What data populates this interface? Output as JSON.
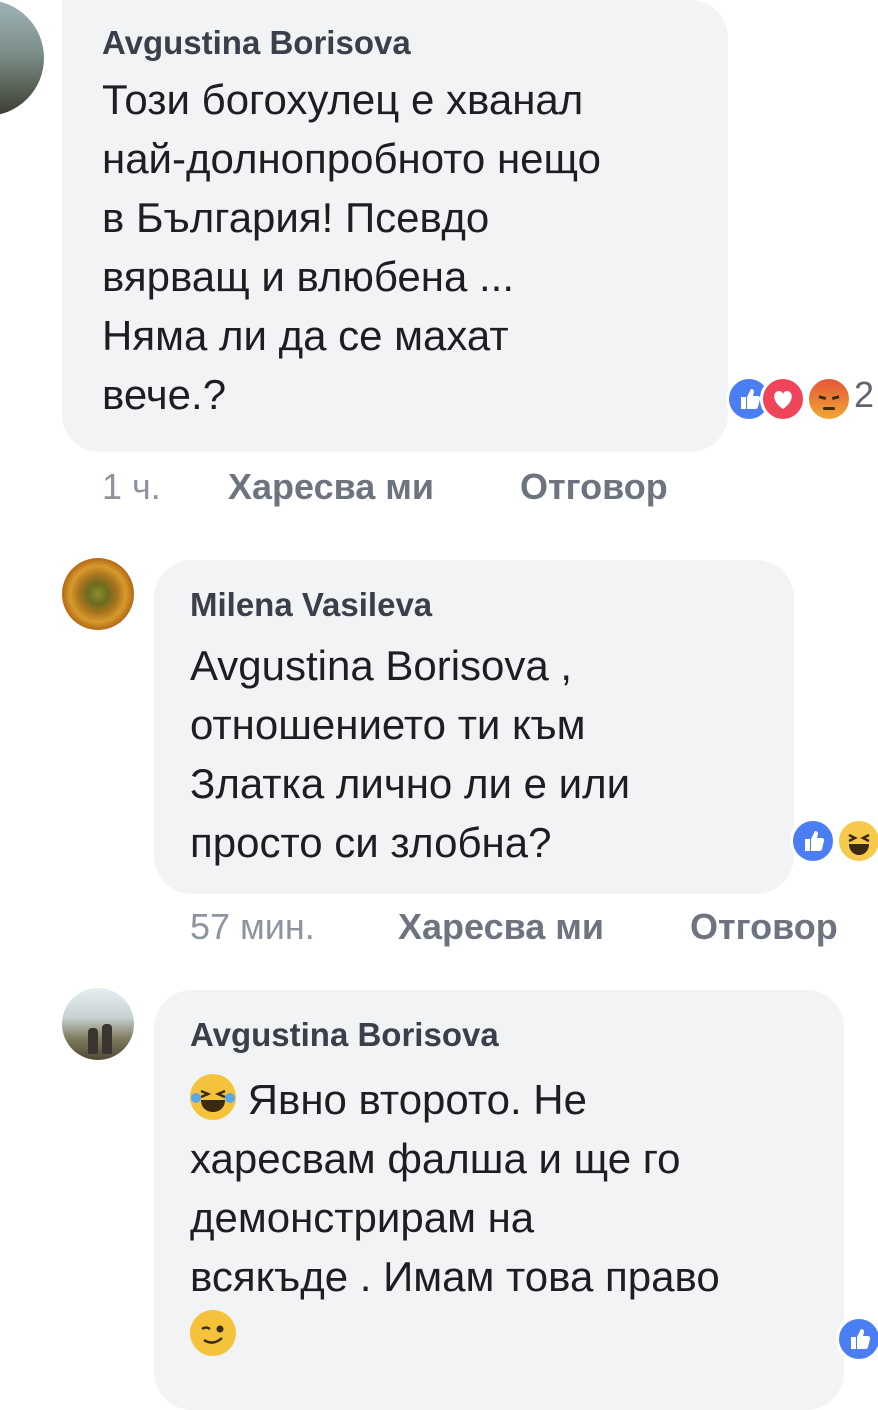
{
  "comments": [
    {
      "author": "Avgustina Borisova",
      "lines": [
        "Този богохулец е хванал",
        "най-долнопробното нещо",
        "в България! Псевдо",
        "вярващ и влюбена ...",
        "Няма ли да се махат",
        "вече.?"
      ],
      "time": "1 ч.",
      "like_label": "Харесва ми",
      "reply_label": "Отговор",
      "reactions": [
        "like-icon",
        "love-icon",
        "angry-icon"
      ],
      "reaction_count": "2"
    },
    {
      "author": "Milena Vasileva",
      "lines": [
        "Avgustina Borisova ,",
        "отношението ти към",
        "Златка лично ли е или",
        "просто си злобна?"
      ],
      "time": "57 мин.",
      "like_label": "Харесва ми",
      "reply_label": "Отговор",
      "reactions": [
        "like-icon",
        "haha-icon"
      ]
    },
    {
      "author": "Avgustina Borisova",
      "lines": [
        " Явно второто. Не",
        "харесвам фалша и ще го",
        "демонстрирам на",
        "всякъде . Имам това право"
      ],
      "reactions": [
        "like-icon"
      ]
    }
  ],
  "colors": {
    "bubble": "#f2f3f5",
    "like_blue": "#4a7ef2",
    "love_red": "#f0445a",
    "meta_gray": "#8d949e"
  }
}
